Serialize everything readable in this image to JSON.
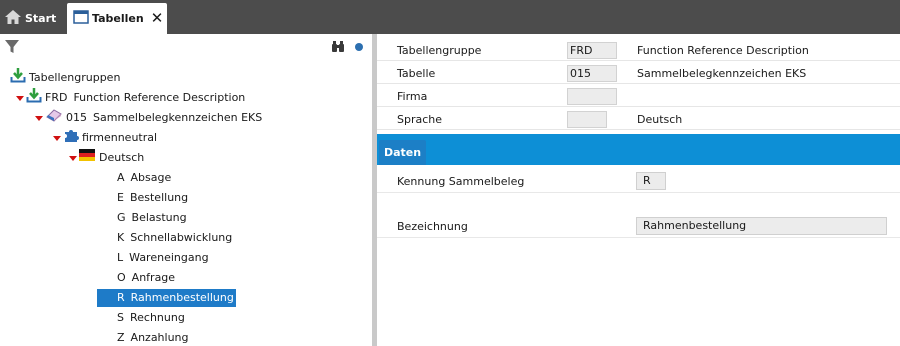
{
  "tabs": {
    "start_label": "Start",
    "tabellen_label": "Tabellen"
  },
  "tree": {
    "root_label": "Tabellengruppen",
    "group": {
      "code": "FRD",
      "label": "Function Reference Description"
    },
    "table": {
      "code": "015",
      "label": "Sammelbelegkennzeichen EKS"
    },
    "company": "firmenneutral",
    "language": "Deutsch",
    "entries": [
      {
        "code": "A",
        "label": "Absage"
      },
      {
        "code": "E",
        "label": "Bestellung"
      },
      {
        "code": "G",
        "label": "Belastung"
      },
      {
        "code": "K",
        "label": "Schnellabwicklung"
      },
      {
        "code": "L",
        "label": "Wareneingang"
      },
      {
        "code": "O",
        "label": "Anfrage"
      },
      {
        "code": "R",
        "label": "Rahmenbestellung"
      },
      {
        "code": "S",
        "label": "Rechnung"
      },
      {
        "code": "Z",
        "label": "Anzahlung"
      }
    ],
    "selected_index": 6
  },
  "header": {
    "rows": [
      {
        "label": "Tabellengruppe",
        "value": "FRD",
        "desc": "Function Reference Description"
      },
      {
        "label": "Tabelle",
        "value": "015",
        "desc": "Sammelbelegkennzeichen EKS"
      },
      {
        "label": "Firma",
        "value": "",
        "desc": ""
      },
      {
        "label": "Sprache",
        "value": "",
        "desc": "Deutsch"
      }
    ]
  },
  "section": {
    "tab_label": "Daten",
    "fields": [
      {
        "label": "Kennung Sammelbeleg",
        "value": "R"
      },
      {
        "label": "Bezeichnung",
        "value": "Rahmenbestellung"
      }
    ]
  },
  "colors": {
    "accent": "#0d8fd6",
    "selection": "#1e7bc8",
    "topbar": "#4c4c4c",
    "expand_triangle": "#d01010"
  }
}
